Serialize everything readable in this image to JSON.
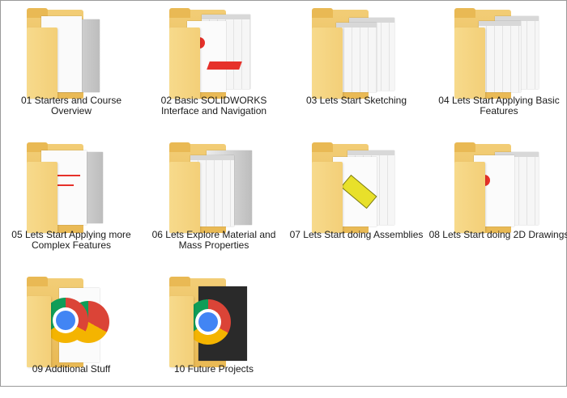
{
  "folders": [
    {
      "name": "01 Starters and Course Overview",
      "icon": "folder-presentation-icon"
    },
    {
      "name": "02 Basic SOLIDWORKS Interface and Navigation",
      "icon": "folder-solidworks-icon"
    },
    {
      "name": "03 Lets Start Sketching",
      "icon": "folder-screenshots-icon"
    },
    {
      "name": "04 Lets Start Applying Basic Features",
      "icon": "folder-screenshots-icon"
    },
    {
      "name": "05 Lets Start Applying more Complex Features",
      "icon": "folder-presentation-icon"
    },
    {
      "name": "06 Lets Explore Material and Mass Properties",
      "icon": "folder-screenshots-icon"
    },
    {
      "name": "07 Lets Start doing Assemblies",
      "icon": "folder-assembly-icon"
    },
    {
      "name": "08 Lets Start doing 2D Drawings",
      "icon": "folder-solidworks-icon"
    },
    {
      "name": "09 Additional Stuff",
      "icon": "folder-chrome-icon"
    },
    {
      "name": "10 Future Projects",
      "icon": "folder-chrome-icon"
    }
  ],
  "colors": {
    "folder_back": "#e9b954",
    "folder_front": "#f3cf78",
    "accent_red": "#e6312a",
    "assembly_yellow": "#e8e02a"
  }
}
